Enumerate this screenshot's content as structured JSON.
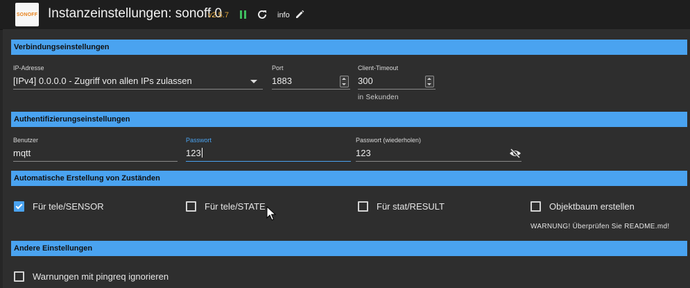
{
  "header": {
    "logo_text": "SONOFF",
    "title": "Instanzeinstellungen: sonoff.0",
    "version": "v2.5.7",
    "info_label": "info",
    "icons": [
      "pause-icon",
      "refresh-icon",
      "edit-icon"
    ]
  },
  "sections": {
    "connection": "Verbindungseinstellungen",
    "auth": "Authentifizierungseinstellungen",
    "states": "Automatische Erstellung von Zuständen",
    "other": "Andere Einstellungen"
  },
  "connection": {
    "ip_label": "IP-Adresse",
    "ip_value": "[IPv4] 0.0.0.0 - Zugriff von allen IPs zulassen",
    "port_label": "Port",
    "port_value": "1883",
    "timeout_label": "Client-Timeout",
    "timeout_value": "300",
    "timeout_hint": "in Sekunden"
  },
  "auth": {
    "user_label": "Benutzer",
    "user_value": "mqtt",
    "pass_label": "Passwort",
    "pass_value": "123",
    "pass2_label": "Passwort (wiederholen)",
    "pass2_value": "123"
  },
  "states": {
    "items": [
      {
        "label": "Für tele/SENSOR",
        "checked": true
      },
      {
        "label": "Für tele/STATE",
        "checked": false
      },
      {
        "label": "Für stat/RESULT",
        "checked": false
      },
      {
        "label": "Objektbaum erstellen",
        "checked": false
      }
    ],
    "warning": "WARNUNG! Überprüfen Sie README.md!"
  },
  "other": {
    "items": [
      {
        "label": "Warnungen mit pingreq ignorieren",
        "checked": false
      }
    ]
  },
  "colors": {
    "accent": "#4aa3f0",
    "version": "#e0a43a",
    "pause": "#3fbf5f",
    "background": "#2e2e2e"
  }
}
